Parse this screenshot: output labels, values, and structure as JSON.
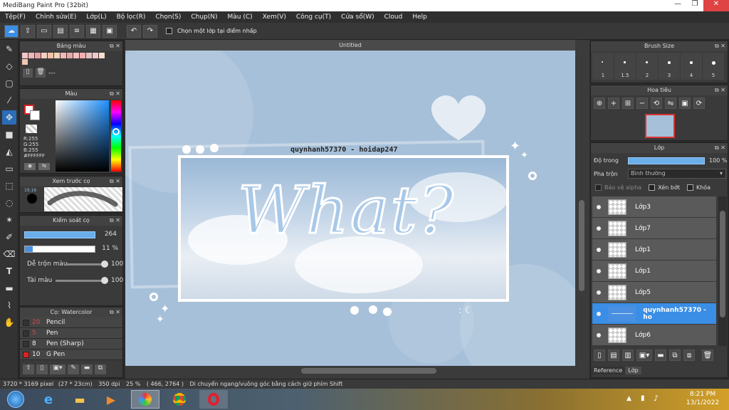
{
  "app_title": "MediBang Paint Pro (32bit)",
  "menu": [
    "Tệp(F)",
    "Chỉnh sửa(E)",
    "Lớp(L)",
    "Bộ lọc(R)",
    "Chọn(S)",
    "Chụp(N)",
    "Màu (C)",
    "Xem(V)",
    "Công cụ(T)",
    "Cửa sổ(W)",
    "Cloud",
    "Help"
  ],
  "toolbar": {
    "checkbox_label": "Chọn một lớp tại điểm nhấp"
  },
  "palette": {
    "title": "Bảng màu",
    "label": "---",
    "colors": [
      "#f3c7c7",
      "#f0b6b6",
      "#e8a1a1",
      "#f7d0c0",
      "#f2c2a8",
      "#f5d5b8",
      "#f3b9b9",
      "#e9a8a8",
      "#f5c0c0",
      "#f2b0b0",
      "#e7c1c1",
      "#f0c8c8",
      "#f8dcd0",
      "#f2c5b5"
    ]
  },
  "color_panel": {
    "title": "Màu",
    "r": "R:255",
    "g": "G:255",
    "b": "B:255",
    "hex": "#FFFFFF"
  },
  "brush_preview": {
    "title": "Xem trước cọ",
    "size": "19.16"
  },
  "control": {
    "title": "Kiểm soát cọ",
    "size_value": "264",
    "opacity_value": "11 %",
    "mix_label": "Dễ trộn màu",
    "mix_value": "100",
    "resource_label": "Tài màu",
    "resource_value": "100"
  },
  "brush_list": {
    "title": "Cọ: Watercolor",
    "items": [
      {
        "size": "20",
        "name": "Pencil",
        "color": "#333333",
        "size_color": "#e04343"
      },
      {
        "size": "5",
        "name": "Pen",
        "color": "#333333",
        "size_color": "#e04343"
      },
      {
        "size": "8",
        "name": "Pen (Sharp)",
        "color": "#333333",
        "size_color": "#eeeeee"
      },
      {
        "size": "10",
        "name": "G Pen",
        "color": "#e02020",
        "size_color": "#eeeeee"
      }
    ]
  },
  "document": {
    "tab": "Untitled",
    "header_text": "quynhanh57370 - hoidap247",
    "headline": "What?"
  },
  "status": {
    "dims": "3720 * 3169 pixel",
    "cm": "(27 * 23cm)",
    "dpi": "350 dpi",
    "zoom": "25 %",
    "coords": "( 466, 2764 )",
    "hint": "Di chuyển ngang/vuông góc bằng cách giữ phím Shift"
  },
  "brush_size": {
    "title": "Brush Size",
    "values": [
      "1",
      "1.5",
      "2",
      "3",
      "4",
      "5"
    ]
  },
  "navigator": {
    "title": "Hoa tiêu"
  },
  "layers": {
    "title": "Lớp",
    "opacity_label": "Độ trong",
    "opacity_value": "100 %",
    "blend_label": "Pha trộn",
    "blend_value": "Bình thường",
    "protect_alpha": "Bảo vệ alpha",
    "clip": "Xén bớt",
    "lock": "Khóa",
    "items": [
      {
        "name": "Lớp3"
      },
      {
        "name": "Lớp7"
      },
      {
        "name": "Lớp1"
      },
      {
        "name": "Lớp1"
      },
      {
        "name": "Lớp5"
      },
      {
        "name": "quynhanh57370 - ho"
      },
      {
        "name": "Lớp6"
      }
    ],
    "tab_reference": "Reference",
    "tab_layer": "Lớp"
  },
  "clock": {
    "time": "8:21 PM",
    "date": "13/1/2022"
  }
}
